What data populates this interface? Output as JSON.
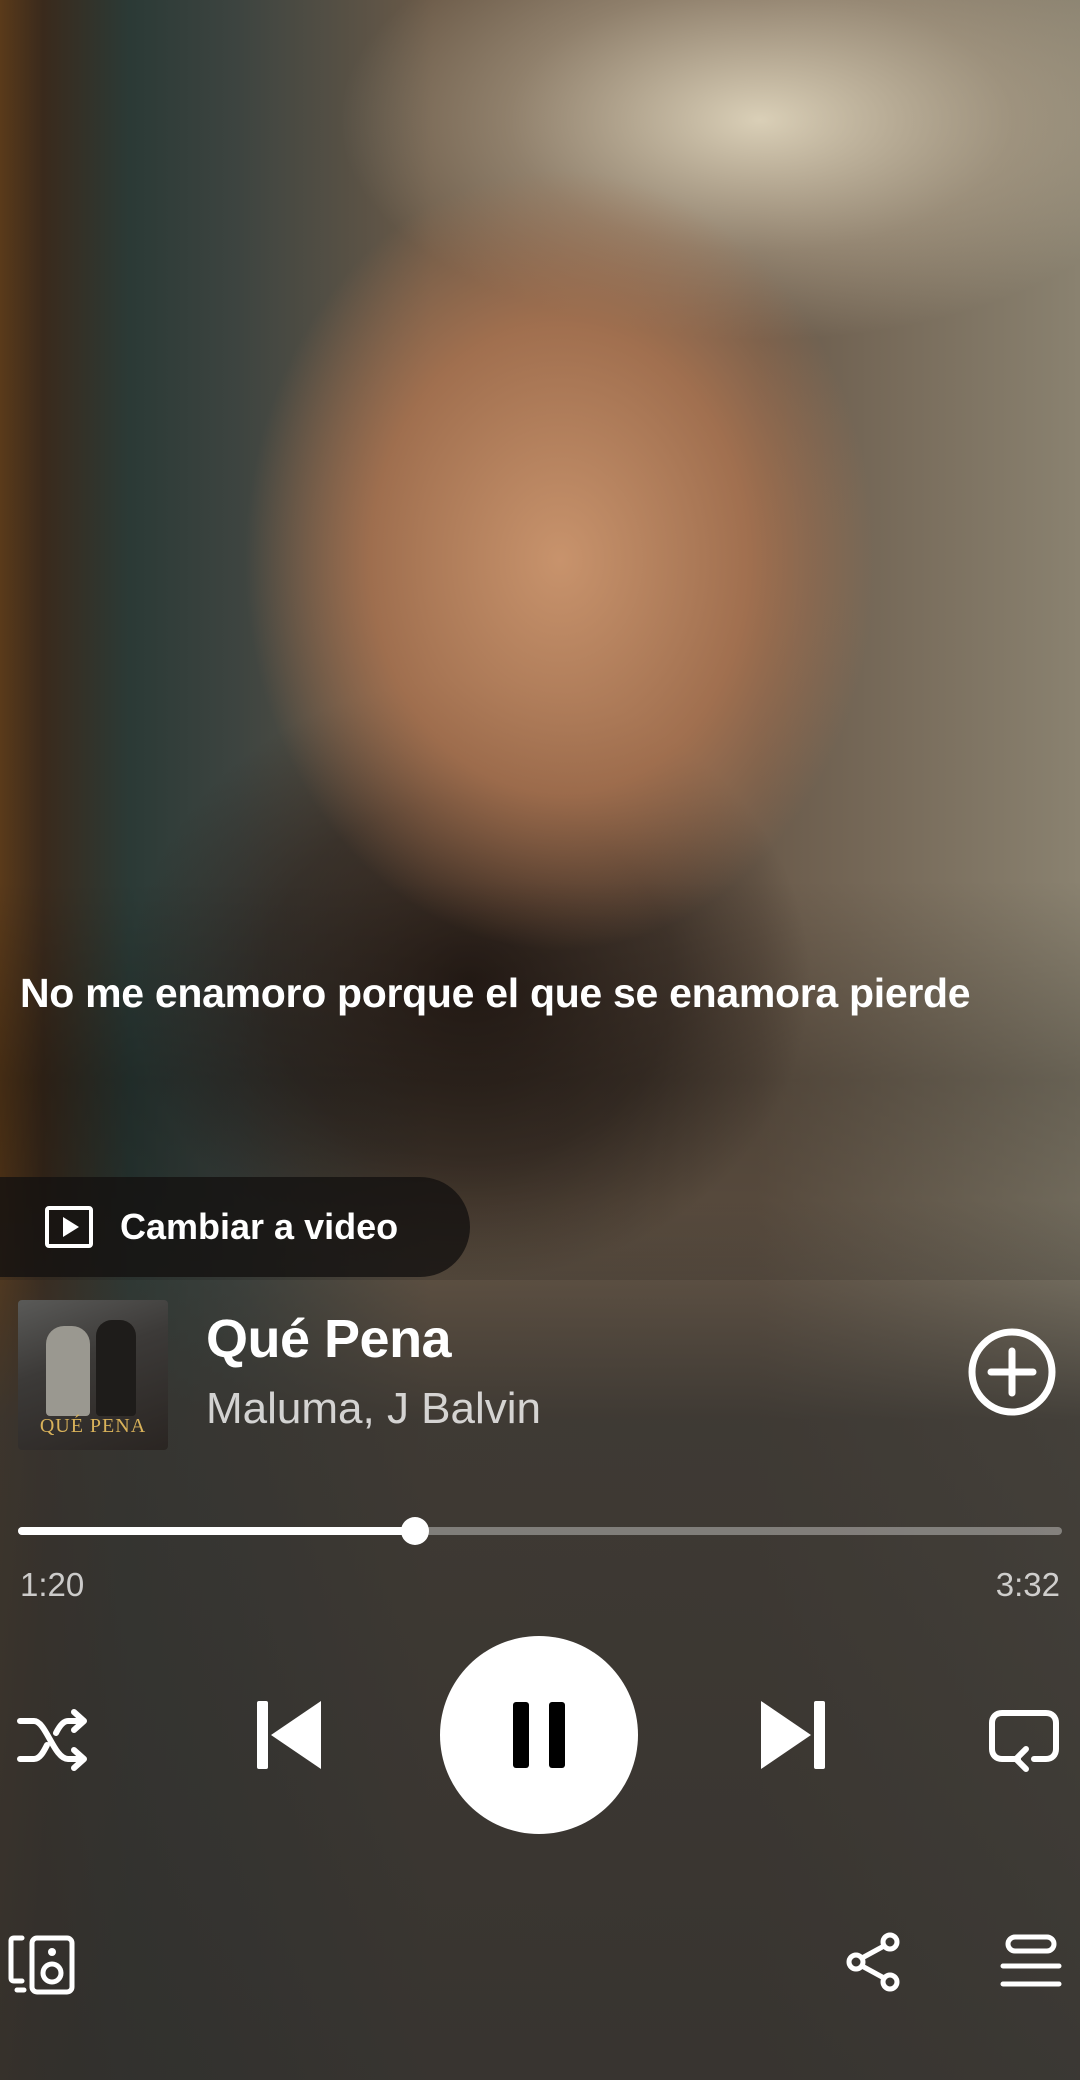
{
  "lyrics": {
    "current_line": "No me enamoro porque el que se enamora pierde"
  },
  "switch_video": {
    "label": "Cambiar a video",
    "icon": "video-play-icon"
  },
  "track": {
    "cover_text": "QUÉ PENA",
    "title": "Qué Pena",
    "artist": "Maluma, J Balvin",
    "add_icon": "plus-circle-icon"
  },
  "playback": {
    "elapsed": "1:20",
    "total": "3:32",
    "progress_fraction": 0.38
  },
  "controls": {
    "shuffle": "shuffle-icon",
    "previous": "skip-previous-icon",
    "play_pause": "pause-icon",
    "next": "skip-next-icon",
    "repeat": "repeat-icon"
  },
  "footer": {
    "devices": "connect-devices-icon",
    "share": "share-icon",
    "queue": "queue-icon"
  }
}
